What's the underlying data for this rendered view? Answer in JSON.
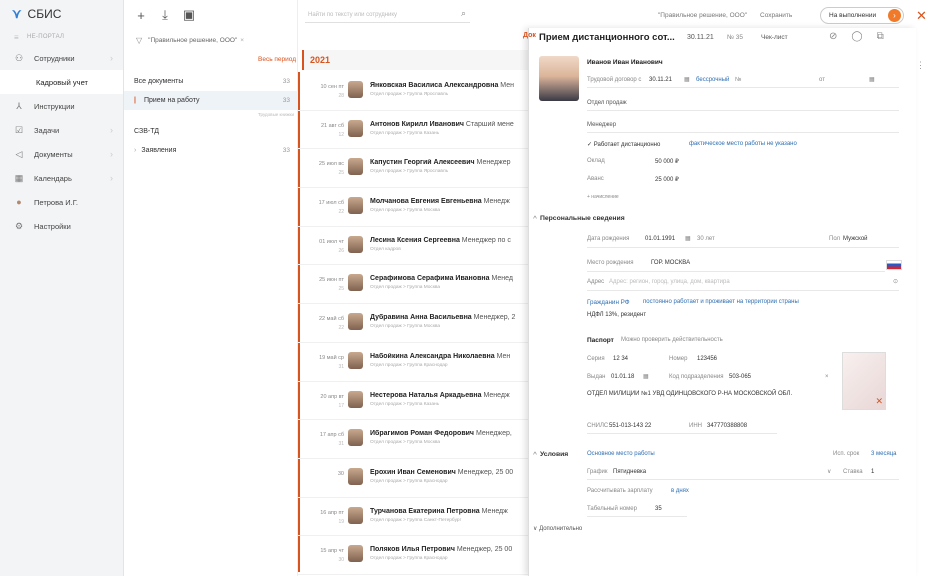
{
  "nav": {
    "logo": "СБИС",
    "portal": "НЕ-ПОРТАЛ",
    "items": [
      {
        "label": "Сотрудники",
        "icon": "people-icon"
      },
      {
        "label": "Кадровый учет",
        "icon": ""
      },
      {
        "label": "Инструкции",
        "icon": "flag-icon"
      },
      {
        "label": "Задачи",
        "icon": "checkbox-icon"
      },
      {
        "label": "Документы",
        "icon": "send-icon"
      },
      {
        "label": "Календарь",
        "icon": "calendar-icon"
      },
      {
        "label": "Петрова И.Г.",
        "icon": "user-icon"
      },
      {
        "label": "Настройки",
        "icon": "gear-icon"
      }
    ]
  },
  "toolbar": {
    "plus": "+",
    "download": "⤓",
    "archive": "▣"
  },
  "filter": {
    "label": "\"Правильное решение, ООО\""
  },
  "period_label": "Весь период",
  "doclist": [
    {
      "label": "Все документы",
      "count": "33"
    },
    {
      "label": "Прием на работу",
      "count": "33"
    },
    {
      "label": "СЗВ-ТД",
      "count": ""
    },
    {
      "label": "Заявления",
      "count": "33"
    }
  ],
  "hint": "Трудовые книжки",
  "search": {
    "placeholder": "Найти по тексту или сотруднику"
  },
  "year": "2021",
  "rows": [
    {
      "date": "10 сен пт",
      "sub": "28",
      "name": "Янковская Василиса Александровна",
      "role": " Мен",
      "dept": "Отдел продаж > Группа Ярославль"
    },
    {
      "date": "21 авг сб",
      "sub": "12",
      "name": "Антонов Кирилл Иванович",
      "role": " Старший мене",
      "dept": "Отдел продаж > Группа Казань"
    },
    {
      "date": "25 июл вс",
      "sub": "25",
      "name": "Капустин Георгий Алексеевич",
      "role": " Менеджер",
      "dept": "Отдел продаж > Группа Ярославль"
    },
    {
      "date": "17 июл сб",
      "sub": "22",
      "name": "Молчанова Евгения Евгеньевна",
      "role": " Менедж",
      "dept": "Отдел продаж > Группа Москва"
    },
    {
      "date": "01 июл чт",
      "sub": "26",
      "name": "Лесина Ксения Сергеевна",
      "role": " Менеджер по с",
      "dept": "Отдел кадров"
    },
    {
      "date": "25 июн пт",
      "sub": "25",
      "name": "Серафимова Серафима Ивановна",
      "role": " Менед",
      "dept": "Отдел продаж > Группа Москва"
    },
    {
      "date": "22 май сб",
      "sub": "22",
      "name": "Дубравина Анна Васильевна",
      "role": " Менеджер, 2",
      "dept": "Отдел продаж > Группа Москва"
    },
    {
      "date": "19 май ср",
      "sub": "31",
      "name": "Набойкина Александра Николаевна",
      "role": " Мен",
      "dept": "Отдел продаж > Группа Краснодар"
    },
    {
      "date": "20 апр вт",
      "sub": "17",
      "name": "Нестерова Наталья Аркадьевна",
      "role": " Менедж",
      "dept": "Отдел продаж > Группа Казань"
    },
    {
      "date": "17 апр сб",
      "sub": "31",
      "name": "Ибрагимов Роман Федорович",
      "role": " Менеджер,",
      "dept": "Отдел продаж > Группа Москва"
    },
    {
      "date": "30",
      "sub": "",
      "name": "Ерохин Иван Семенович",
      "role": " Менеджер, 25 00",
      "dept": "Отдел продаж > Группа Краснодар"
    },
    {
      "date": "16 апр пт",
      "sub": "19",
      "name": "Турчанова Екатерина Петровна",
      "role": " Менедж",
      "dept": "Отдел продаж > Группа Санкт-Петербург"
    },
    {
      "date": "15 апр чт",
      "sub": "30",
      "name": "Поляков Илья Петрович",
      "role": " Менеджер, 25 00",
      "dept": "Отдел продаж > Группа Краснодар"
    }
  ],
  "topbar": {
    "source": "\"Правильное решение, ООО\"",
    "save": "Сохранить",
    "status": "На выполнении"
  },
  "panel": {
    "title": "Прием дистанционного сот...",
    "date": "30.11.21",
    "number": "№ 35",
    "checklist": "Чек-лист",
    "first_name": "Иванов   Иван   Иванович",
    "contract_label": "Трудовой договор с",
    "contract_date": "30.11.21",
    "contract_term": "бессрочный",
    "contract_no": "№",
    "from_label": "от",
    "dept": "Отдел продаж",
    "position": "Менеджер",
    "remote": "✓ Работает дистанционно",
    "remote_note": "фактическое место работы не указано",
    "salary_label": "Оклад",
    "salary": "50 000 ₽",
    "advance_label": "Аванс",
    "advance": "25 000 ₽",
    "accrual": "+ начисление",
    "personal_section": "Персональные сведения",
    "birth_label": "Дата рождения",
    "birth": "01.01.1991",
    "age": "30 лет",
    "sex_label": "Пол",
    "sex": "Мужской",
    "birthplace_label": "Место рождения",
    "birthplace": "ГОР. МОСКВА",
    "address_label": "Адрес",
    "address_placeholder": "Адрес: регион, город, улица, дом, квартира",
    "citizenship": "Гражданин РФ",
    "citizenship_note": "постоянно работает и проживает на территории страны",
    "tax": "НДФЛ 13%, резидент",
    "passport_label": "Паспорт",
    "passport_check": "Можно проверить действительность",
    "series_label": "Серия",
    "series": "12 34",
    "num_label": "Номер",
    "num": "123456",
    "issued_label": "Выдан",
    "issued": "01.01.18",
    "code_label": "Код подразделения",
    "code": "503-065",
    "issuer": "ОТДЕЛ МИЛИЦИИ №1 УВД ОДИНЦОВСКОГО Р-НА МОСКОВСКОЙ ОБЛ.",
    "snils_label": "СНИЛС",
    "snils": "551-013-143 22",
    "inn_label": "ИНН",
    "inn": "347770388808",
    "conditions_label": "Условия",
    "work_place": "Основное место работы",
    "trial_label": "Исп. срок",
    "trial": "3 месяца",
    "schedule_label": "График",
    "schedule": "Пятидневка",
    "rate_label": "Ставка",
    "rate": "1",
    "pay_label": "Рассчитывать зарплату",
    "pay": "в днях",
    "tab_label": "Табельный номер",
    "tab_no": "35",
    "more": "Дополнительно"
  }
}
